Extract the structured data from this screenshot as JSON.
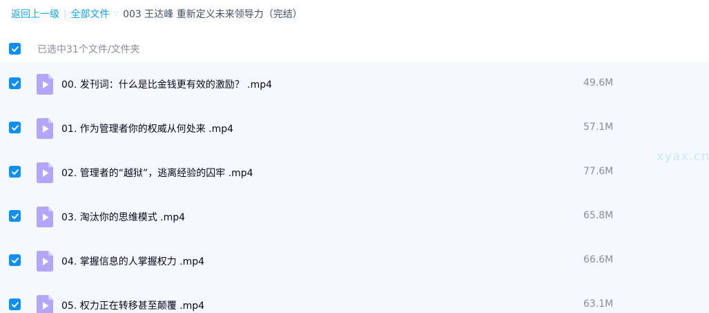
{
  "breadcrumb": {
    "back": "返回上一级",
    "separator": "|",
    "all_files": "全部文件",
    "arrow": "▽",
    "current": "003 王达峰 重新定义未来领导力（完结）"
  },
  "selection": {
    "summary": "已选中31个文件/文件夹",
    "all_checked": true
  },
  "files": [
    {
      "name": "00. 发刊词：什么是比金钱更有效的激励？ .mp4",
      "size": "49.6M",
      "checked": true,
      "icon": "video-file-icon"
    },
    {
      "name": "01. 作为管理者你的权威从何处来 .mp4",
      "size": "57.1M",
      "checked": true,
      "icon": "video-file-icon"
    },
    {
      "name": "02. 管理者的“越狱”，逃离经验的囚牢 .mp4",
      "size": "77.6M",
      "checked": true,
      "icon": "video-file-icon"
    },
    {
      "name": "03. 淘汰你的思维模式 .mp4",
      "size": "65.8M",
      "checked": true,
      "icon": "video-file-icon"
    },
    {
      "name": "04. 掌握信息的人掌握权力 .mp4",
      "size": "66.6M",
      "checked": true,
      "icon": "video-file-icon"
    },
    {
      "name": "05. 权力正在转移甚至颠覆 .mp4",
      "size": "63.1M",
      "checked": true,
      "icon": "video-file-icon"
    }
  ],
  "watermark": "xyax.cn",
  "colors": {
    "accent": "#06a7ff",
    "checkbox": "#0e8ff6",
    "list_background": "#f4f9fe",
    "icon": "#b3a5fb"
  }
}
